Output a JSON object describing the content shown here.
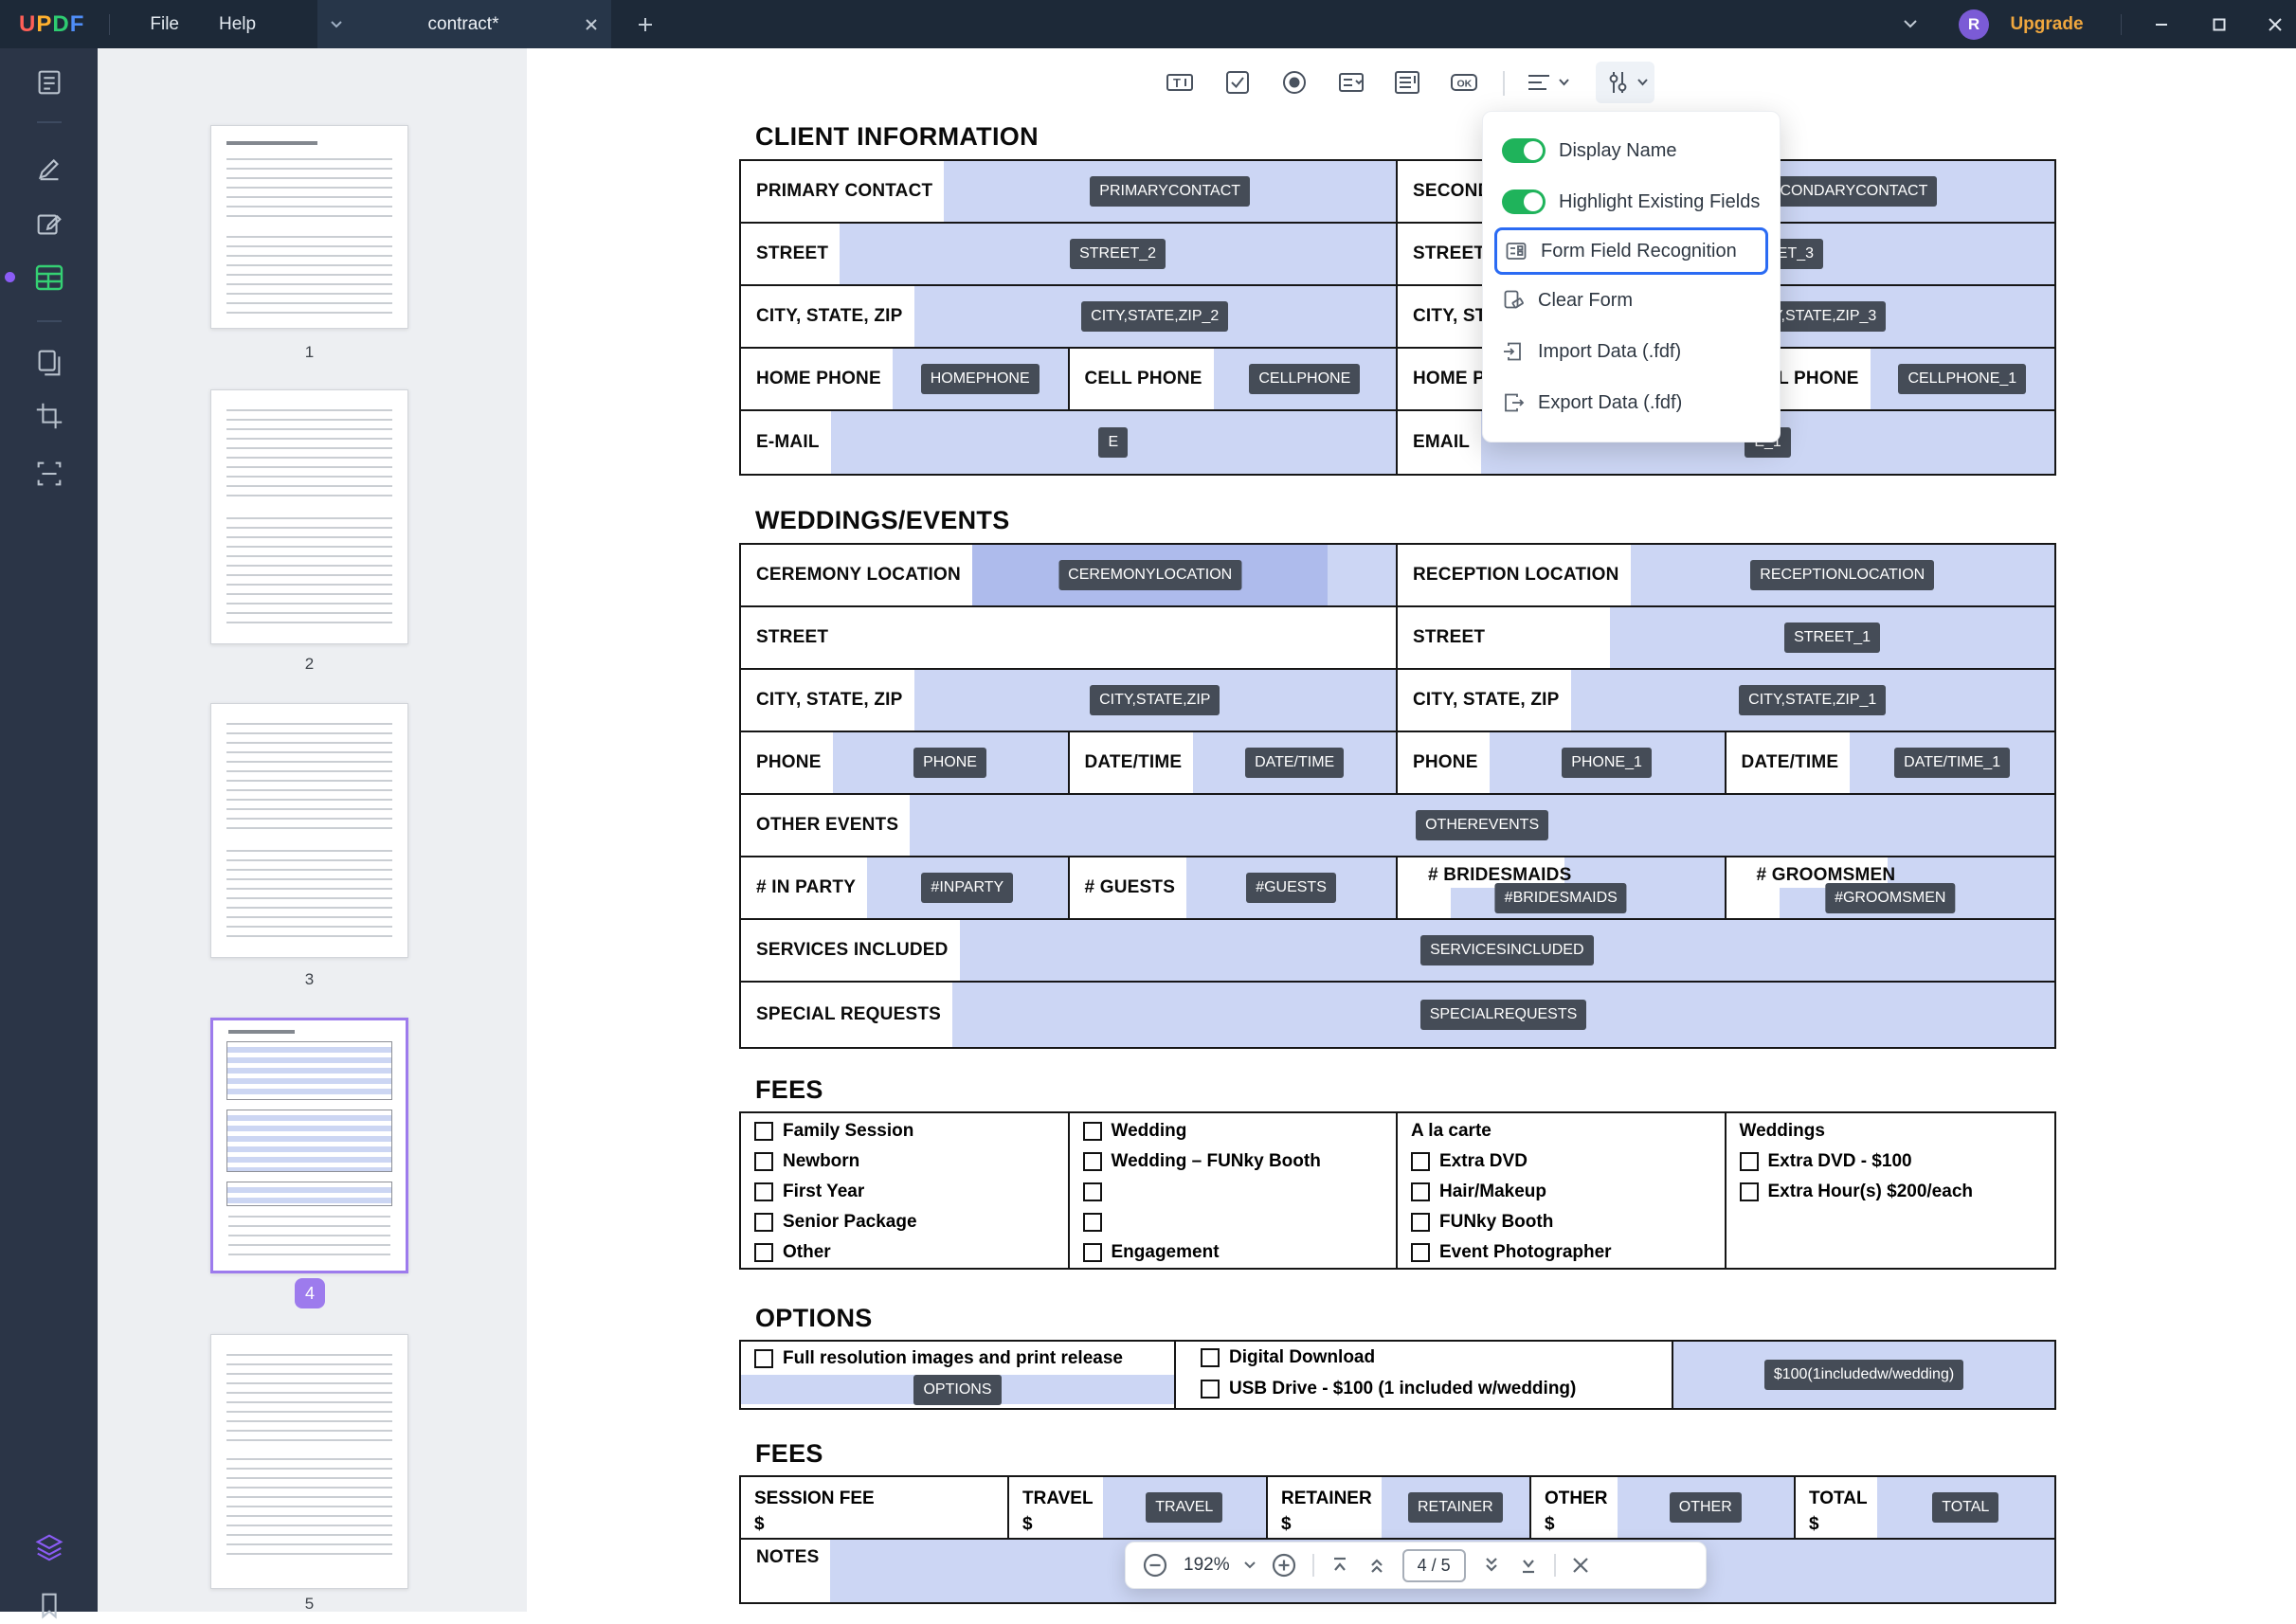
{
  "titlebar": {
    "logo": [
      "U",
      "P",
      "D",
      "F"
    ],
    "file": "File",
    "help": "Help",
    "tab": "contract*",
    "upgrade": "Upgrade",
    "avatar": "R"
  },
  "thumbnails": {
    "pages": [
      "1",
      "2",
      "3",
      "4",
      "5"
    ]
  },
  "toolbar": {
    "text_icon": "T",
    "ok": "OK"
  },
  "menu": {
    "display_name": "Display Name",
    "highlight": "Highlight Existing Fields",
    "recognition": "Form Field Recognition",
    "clear": "Clear Form",
    "import": "Import Data (.fdf)",
    "export": "Export Data (.fdf)"
  },
  "doc": {
    "client": {
      "title": "CLIENT INFORMATION",
      "primary": "PRIMARY CONTACT",
      "primary_tag": "PRIMARYCONTACT",
      "secondary": "SECONDARY CONTACT",
      "secondary_tag": "SECONDARYCONTACT",
      "street_l": "STREET",
      "street_l_tag": "STREET_2",
      "street_r": "STREET",
      "street_r_tag": "STREET_3",
      "csz_l": "CITY, STATE, ZIP",
      "csz_l_tag": "CITY,STATE,ZIP_2",
      "csz_r": "CITY, STATE, ZIP",
      "csz_r_tag": "CITY,STATE,ZIP_3",
      "homephone_l": "HOME PHONE",
      "homephone_l_tag": "HOMEPHONE",
      "cellphone_l": "CELL PHONE",
      "cellphone_l_tag": "CELLPHONE",
      "homephone_r": "HOME PHONE",
      "cellphone_r": "CELL PHONE",
      "cellphone_r_tag": "CELLPHONE_1",
      "email_l": "E-MAIL",
      "email_l_tag": "E",
      "email_r": "EMAIL",
      "email_r_tag": "E_1"
    },
    "weddings": {
      "title": "WEDDINGS/EVENTS",
      "ceremony": "CEREMONY LOCATION",
      "ceremony_tag": "CEREMONYLOCATION",
      "reception": "RECEPTION LOCATION",
      "reception_tag": "RECEPTIONLOCATION",
      "street_l": "STREET",
      "street_r": "STREET",
      "street_r_tag": "STREET_1",
      "csz_l": "CITY, STATE, ZIP",
      "csz_l_tag": "CITY,STATE,ZIP",
      "csz_r": "CITY, STATE, ZIP",
      "csz_r_tag": "CITY,STATE,ZIP_1",
      "phone_l": "PHONE",
      "phone_l_tag": "PHONE",
      "datetime_l": "DATE/TIME",
      "datetime_l_tag": "DATE/TIME",
      "phone_r": "PHONE",
      "phone_r_tag": "PHONE_1",
      "datetime_r": "DATE/TIME",
      "datetime_r_tag": "DATE/TIME_1",
      "other_events": "OTHER EVENTS",
      "other_events_tag": "OTHEREVENTS",
      "in_party": "# IN PARTY",
      "in_party_tag": "#INPARTY",
      "guests": "# GUESTS",
      "guests_tag": "#GUESTS",
      "bridesmaids": "# BRIDESMAIDS",
      "bridesmaids_tag": "#BRIDESMAIDS",
      "groomsmen": "# GROOMSMEN",
      "groomsmen_tag": "#GROOMSMEN",
      "services": "SERVICES INCLUDED",
      "services_tag": "SERVICESINCLUDED",
      "special": "SPECIAL REQUESTS",
      "special_tag": "SPECIALREQUESTS"
    },
    "fees1": {
      "title": "FEES",
      "col1": [
        "Family Session",
        "Newborn",
        "First Year",
        "Senior Package",
        "Other"
      ],
      "col2": [
        "Wedding",
        "Wedding – FUNky Booth",
        "",
        "",
        "Engagement"
      ],
      "col3_header": "A la carte",
      "col3": [
        "Extra DVD",
        "Hair/Makeup",
        "FUNky Booth",
        "Event Photographer"
      ],
      "col4_header": "Weddings",
      "col4": [
        "Extra DVD - $100",
        "Extra Hour(s) $200/each"
      ]
    },
    "options": {
      "title": "OPTIONS",
      "full_res": "Full resolution images and print release",
      "full_res_tag": "OPTIONS",
      "digital": "Digital Download",
      "usb": "USB Drive - $100 (1 included w/wedding)",
      "price_tag": "$100(1includedw/wedding)"
    },
    "fees2": {
      "title": "FEES",
      "session": "SESSION FEE",
      "dollar": "$",
      "travel": "TRAVEL",
      "travel_tag": "TRAVEL",
      "retainer": "RETAINER",
      "retainer_tag": "RETAINER",
      "other": "OTHER",
      "other_tag": "OTHER",
      "total": "TOTAL",
      "total_tag": "TOTAL",
      "notes": "NOTES"
    }
  },
  "statusbar": {
    "zoom": "192%",
    "page": "4 / 5"
  },
  "colors": {
    "titlebar": "#1d2938",
    "sidebar": "#2b3547",
    "accent_green": "#1fb35b",
    "field_blue": "#ccd6f4",
    "field_blue_selected": "#aebbec",
    "tag_bg": "#454c57",
    "selection_purple": "#9d7bed",
    "ffr_highlight": "#2b6bf3",
    "upgrade_gold": "#f0a73e",
    "active_tool_green": "#35d073"
  }
}
